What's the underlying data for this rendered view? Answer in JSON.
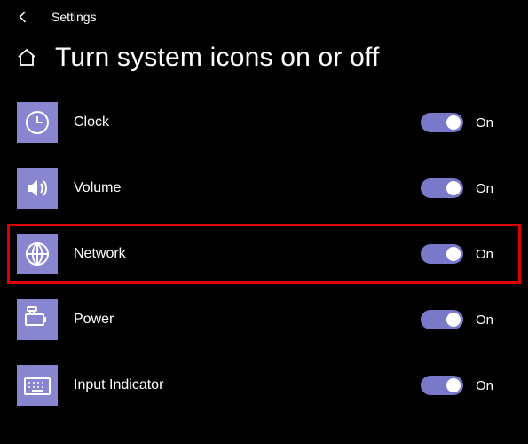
{
  "app": {
    "name": "Settings",
    "title": "Turn system icons on or off"
  },
  "colors": {
    "accent": "#8886d0",
    "highlight": "#e00000"
  },
  "items": [
    {
      "icon": "clock-icon",
      "label": "Clock",
      "state": "On",
      "highlight": false
    },
    {
      "icon": "volume-icon",
      "label": "Volume",
      "state": "On",
      "highlight": false
    },
    {
      "icon": "globe-icon",
      "label": "Network",
      "state": "On",
      "highlight": true
    },
    {
      "icon": "power-icon",
      "label": "Power",
      "state": "On",
      "highlight": false
    },
    {
      "icon": "keyboard-icon",
      "label": "Input Indicator",
      "state": "On",
      "highlight": false
    }
  ]
}
